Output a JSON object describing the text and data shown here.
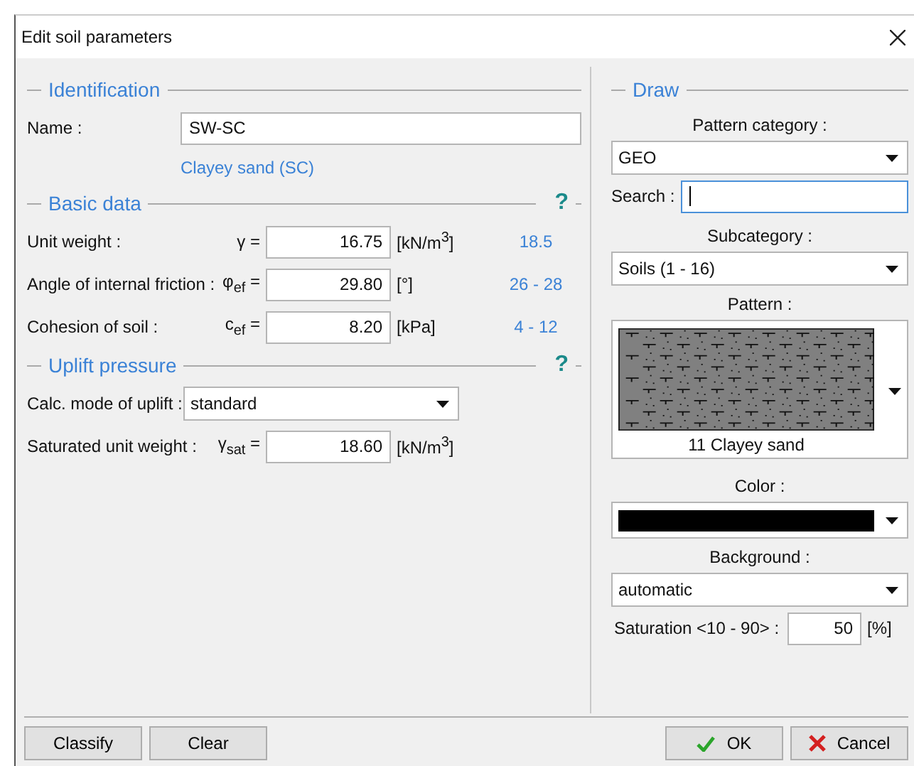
{
  "window": {
    "title": "Edit soil parameters"
  },
  "identification": {
    "title": "Identification",
    "name_label": "Name :",
    "name_value": "SW-SC",
    "classification": "Clayey sand (SC)"
  },
  "basic_data": {
    "title": "Basic data",
    "help": "?",
    "rows": [
      {
        "label": "Unit weight :",
        "symbol": "γ =",
        "value": "16.75",
        "unit": "[kN/m$^{3}$]",
        "range": "18.5"
      },
      {
        "label": "Angle of internal friction :",
        "symbol": "φ$_{ef}$ =",
        "value": "29.80",
        "unit": "[°]",
        "range": "26 - 28"
      },
      {
        "label": "Cohesion of soil :",
        "symbol": "c$_{ef}$ =",
        "value": "8.20",
        "unit": "[kPa]",
        "range": "4 - 12"
      }
    ]
  },
  "uplift": {
    "title": "Uplift pressure",
    "help": "?",
    "mode_label": "Calc. mode of uplift :",
    "mode_value": "standard",
    "rows": [
      {
        "label": "Saturated unit weight :",
        "symbol": "γ$_{sat}$ =",
        "value": "18.60",
        "unit": "[kN/m$^{3}$]"
      }
    ]
  },
  "draw": {
    "title": "Draw",
    "category_label": "Pattern category :",
    "category_value": "GEO",
    "search_label": "Search :",
    "subcategory_label": "Subcategory :",
    "subcategory_value": "Soils (1 - 16)",
    "pattern_label": "Pattern :",
    "pattern_name": "11 Clayey sand",
    "color_label": "Color :",
    "color": "#000000",
    "background_label": "Background :",
    "background_value": "automatic",
    "saturation_label": "Saturation <10 - 90> :",
    "saturation_value": "50",
    "saturation_unit": "[%]"
  },
  "buttons": {
    "left": [
      "Classify",
      "Clear"
    ],
    "ok": "OK",
    "cancel": "Cancel"
  }
}
